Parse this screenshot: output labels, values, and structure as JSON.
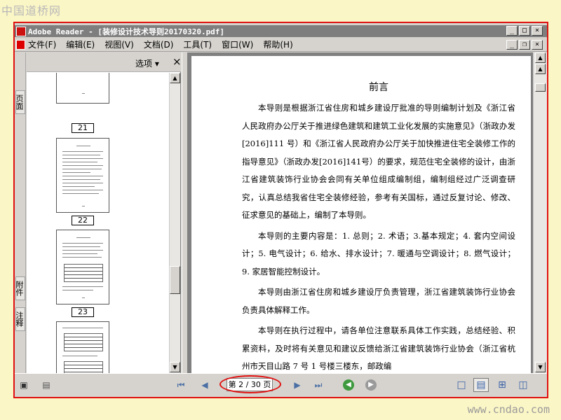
{
  "watermark": {
    "top": "中国道桥网",
    "bottom": "www.cndao.com"
  },
  "window": {
    "title": "Adobe Reader - [装修设计技术导则20170320.pdf]",
    "controls": {
      "minimize": "_",
      "restore": "□",
      "close": "×"
    }
  },
  "menu": {
    "items": [
      "文件(F)",
      "编辑(E)",
      "视图(V)",
      "文档(D)",
      "工具(T)",
      "窗口(W)",
      "帮助(H)"
    ],
    "controls": {
      "minimize": "_",
      "restore": "❐",
      "close": "×"
    }
  },
  "nav_tabs": [
    "页面",
    "附件",
    "注释"
  ],
  "panel": {
    "options_label": "选项 ▾",
    "close_label": "×",
    "thumbnails": [
      {
        "page": "21"
      },
      {
        "page": "22"
      },
      {
        "page": "23"
      }
    ]
  },
  "document": {
    "title": "前言",
    "paragraphs": [
      "本导则是根据浙江省住房和城乡建设厅批准的导则编制计划及《浙江省人民政府办公厅关于推进绿色建筑和建筑工业化发展的实施意见》（浙政办发[2016]111 号）和《浙江省人民政府办公厅关于加快推进住宅全装修工作的指导意见》（浙政办发[2016]141号）的要求，规范住宅全装修的设计，由浙江省建筑装饰行业协会会同有关单位组成编制组，编制组经过广泛调查研究，认真总结我省住宅全装修经验，参考有关国标，通过反复讨论、修改、征求意见的基础上，编制了本导则。",
      "本导则的主要内容是：1. 总则；2. 术语；3.基本规定；4. 套内空间设计；5. 电气设计；6. 给水、排水设计；7. 暖通与空调设计；8. 燃气设计；9. 家居智能控制设计。",
      "本导则由浙江省住房和城乡建设厅负责管理，浙江省建筑装饰行业协会负责具体解释工作。",
      "本导则在执行过程中，请各单位注意联系具体工作实践，总结经验、积累资料，及时将有关意见和建议反馈给浙江省建筑装饰行业协会（浙江省杭州市天目山路 7 号 1 号楼三楼东，邮政编"
    ]
  },
  "bottom_bar": {
    "page_display": "第 2 / 30 页"
  }
}
